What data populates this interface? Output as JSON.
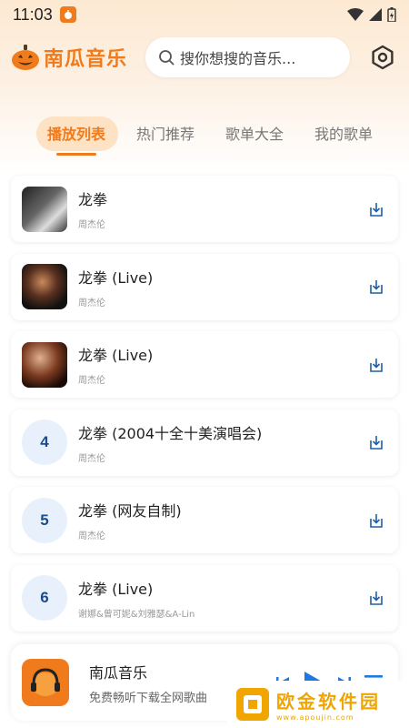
{
  "status": {
    "time": "11:03"
  },
  "header": {
    "app_name": "南瓜音乐",
    "search_placeholder": "搜你想搜的音乐..."
  },
  "tabs": [
    {
      "label": "播放列表",
      "active": true
    },
    {
      "label": "热门推荐",
      "active": false
    },
    {
      "label": "歌单大全",
      "active": false
    },
    {
      "label": "我的歌单",
      "active": false
    }
  ],
  "songs": [
    {
      "index": "1",
      "title": "龙拳",
      "artist": "周杰伦",
      "has_cover": true
    },
    {
      "index": "2",
      "title": "龙拳 (Live)",
      "artist": "周杰伦",
      "has_cover": true
    },
    {
      "index": "3",
      "title": "龙拳 (Live)",
      "artist": "周杰伦",
      "has_cover": true
    },
    {
      "index": "4",
      "title": "龙拳 (2004十全十美演唱会)",
      "artist": "周杰伦",
      "has_cover": false
    },
    {
      "index": "5",
      "title": "龙拳 (网友自制)",
      "artist": "周杰伦",
      "has_cover": false
    },
    {
      "index": "6",
      "title": "龙拳 (Live)",
      "artist": "谢娜&曾可妮&刘雅瑟&A-Lin",
      "has_cover": false
    }
  ],
  "player": {
    "title": "南瓜音乐",
    "subtitle": "免费畅听下载全网歌曲"
  },
  "watermark": {
    "cn": "欧金软件园",
    "url": "www.apoujin.com"
  },
  "colors": {
    "accent": "#f07b1c",
    "number_bg": "#e8f1fb",
    "number_fg": "#1a4c8c",
    "control_blue": "#1f7ae0"
  }
}
